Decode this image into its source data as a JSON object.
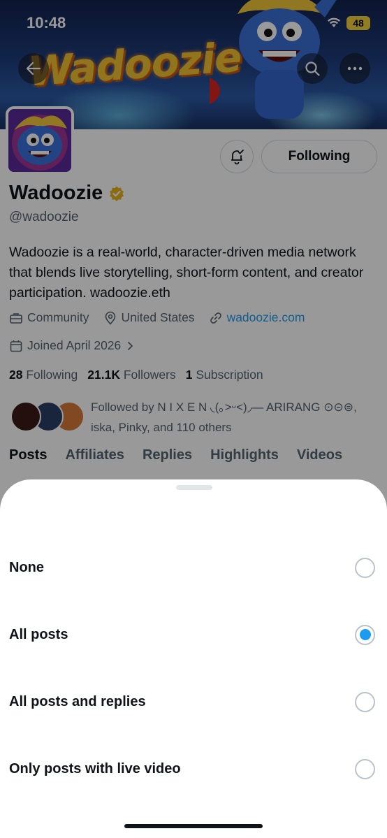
{
  "status_bar": {
    "time": "10:48",
    "battery": "48"
  },
  "banner": {
    "logo_text": "Wadoozie"
  },
  "profile": {
    "following_label": "Following",
    "name": "Wadoozie",
    "handle": "@wadoozie",
    "bio": "Wadoozie is a real-world, character-driven media network that blends live storytelling, short-form content, and creator participation. wadoozie.eth",
    "category": "Community",
    "location": "United States",
    "website": "wadoozie.com",
    "joined": "Joined April 2026",
    "stats": {
      "following_count": "28",
      "following_label": "Following",
      "followers_count": "21.1K",
      "followers_label": "Followers",
      "subscription_count": "1",
      "subscription_label": "Subscription"
    },
    "followed_by": "Followed by N I X E N ◟(｡˃ᵕ˂)◞— ARIRANG ⊙⊝⊜, iska, Pinky, and 110 others"
  },
  "tabs": [
    "Posts",
    "Affiliates",
    "Replies",
    "Highlights",
    "Videos"
  ],
  "notification_sheet": {
    "options": [
      {
        "label": "None",
        "selected": false
      },
      {
        "label": "All posts",
        "selected": true
      },
      {
        "label": "All posts and replies",
        "selected": false
      },
      {
        "label": "Only posts with live video",
        "selected": false
      }
    ]
  },
  "colors": {
    "accent": "#1d9bf0",
    "verified_badge": "#e8b21a",
    "text_secondary": "#536471"
  },
  "icons": [
    "back-arrow-icon",
    "search-icon",
    "more-icon",
    "bell-check-icon",
    "verified-badge-icon",
    "briefcase-icon",
    "location-pin-icon",
    "link-icon",
    "calendar-icon",
    "chevron-right-icon",
    "wifi-icon"
  ]
}
